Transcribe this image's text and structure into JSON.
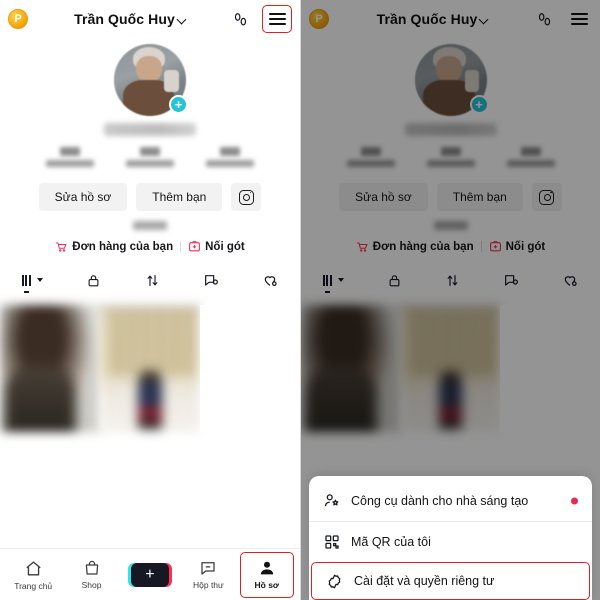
{
  "header": {
    "coin_label": "P",
    "profile_name": "Trần Quốc Huy",
    "chevron_icon": "chevron-down-icon",
    "footsteps_icon": "footsteps-icon",
    "menu_icon": "hamburger-menu-icon"
  },
  "profile": {
    "avatar_icon": "profile-avatar",
    "add_badge": "+",
    "handle_redacted": "",
    "stats": [
      {
        "value": "",
        "label": ""
      },
      {
        "value": "",
        "label": ""
      },
      {
        "value": "",
        "label": ""
      }
    ],
    "buttons": {
      "edit_profile": "Sửa hồ sơ",
      "add_friend": "Thêm bạn",
      "instagram_icon": "instagram-icon"
    },
    "bio_redacted": "",
    "links": [
      {
        "icon": "shopping-cart-icon",
        "label": "Đơn hàng của bạn"
      },
      {
        "icon": "add-tag-icon",
        "label": "Nối gót"
      }
    ]
  },
  "tabs": [
    {
      "icon": "grid-icon",
      "name": "posts-tab",
      "active": true
    },
    {
      "icon": "lock-icon",
      "name": "private-tab",
      "active": false
    },
    {
      "icon": "repost-icon",
      "name": "repost-tab",
      "active": false
    },
    {
      "icon": "tagged-icon",
      "name": "tagged-tab",
      "active": false
    },
    {
      "icon": "heart-hidden-icon",
      "name": "liked-tab",
      "active": false
    }
  ],
  "bottom_nav": [
    {
      "icon": "home-icon",
      "label": "Trang chủ",
      "selected": false
    },
    {
      "icon": "shop-bag-icon",
      "label": "Shop",
      "selected": false
    },
    {
      "icon": "plus-icon",
      "label": "",
      "selected": false
    },
    {
      "icon": "inbox-icon",
      "label": "Hộp thư",
      "selected": false
    },
    {
      "icon": "person-icon",
      "label": "Hồ sơ",
      "selected": true
    }
  ],
  "sheet": {
    "items": [
      {
        "icon": "creator-tools-icon",
        "label": "Công cụ dành cho nhà sáng tạo",
        "badge": true,
        "highlighted": false
      },
      {
        "icon": "qr-code-icon",
        "label": "Mã QR của tôi",
        "badge": false,
        "highlighted": false
      },
      {
        "icon": "settings-gear-icon",
        "label": "Cài đặt và quyền riêng tư",
        "badge": false,
        "highlighted": true
      }
    ]
  },
  "colors": {
    "highlight_red": "#e02020",
    "badge_red": "#f0254b",
    "link_pink": "#fe2c55",
    "accent_cyan": "#22c5d6",
    "coin_gold": "#f9ac12"
  }
}
